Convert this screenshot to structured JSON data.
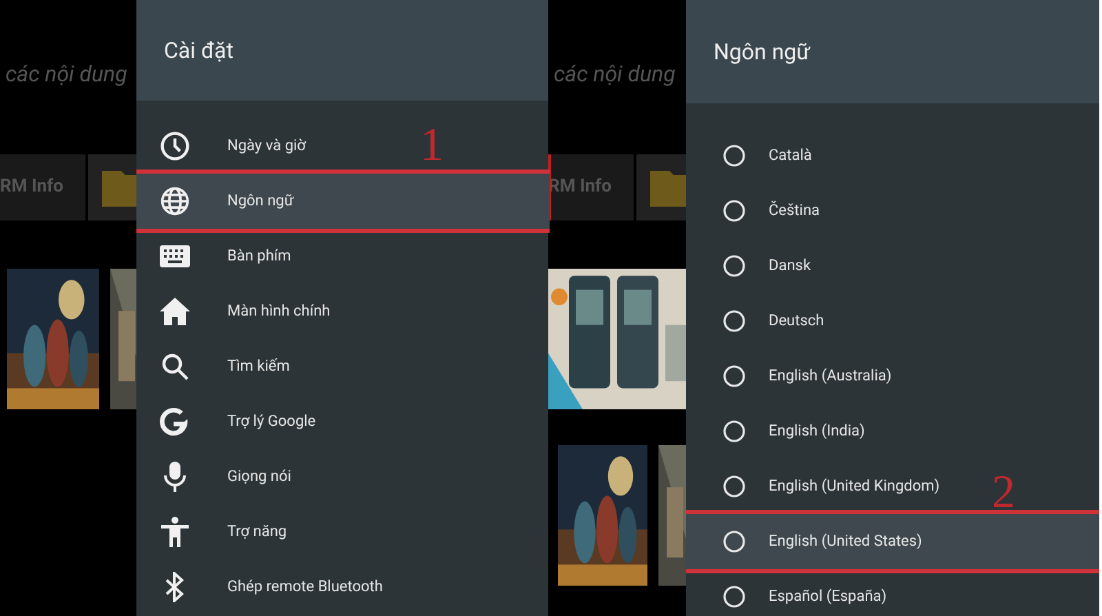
{
  "screens": [
    {
      "background": {
        "caption": "các nội dung",
        "tile": "RM Info"
      },
      "panel": {
        "kind": "menu",
        "title": "Cài đặt",
        "items": [
          {
            "label": "Ngày và giờ",
            "focused": false
          },
          {
            "label": "Ngôn ngữ",
            "focused": true
          },
          {
            "label": "Bàn phím",
            "focused": false
          },
          {
            "label": "Màn hình chính",
            "focused": false
          },
          {
            "label": "Tìm kiếm",
            "focused": false
          },
          {
            "label": "Trợ lý Google",
            "focused": false
          },
          {
            "label": "Giọng nói",
            "focused": false
          },
          {
            "label": "Trợ năng",
            "focused": false
          },
          {
            "label": "Ghép remote Bluetooth",
            "focused": false
          }
        ]
      },
      "annotation": "1"
    },
    {
      "background": {
        "caption": "các nội dung",
        "tile": "RM Info"
      },
      "panel": {
        "kind": "radio_list",
        "title": "Ngôn ngữ",
        "items": [
          {
            "label": "Català",
            "selected": false,
            "focused": false
          },
          {
            "label": "Čeština",
            "selected": false,
            "focused": false
          },
          {
            "label": "Dansk",
            "selected": false,
            "focused": false
          },
          {
            "label": "Deutsch",
            "selected": false,
            "focused": false
          },
          {
            "label": "English (Australia)",
            "selected": false,
            "focused": false
          },
          {
            "label": "English (India)",
            "selected": false,
            "focused": false
          },
          {
            "label": "English (United Kingdom)",
            "selected": false,
            "focused": false
          },
          {
            "label": "English (United States)",
            "selected": false,
            "focused": true
          },
          {
            "label": "Español (España)",
            "selected": false,
            "focused": false
          }
        ]
      },
      "annotation": "2"
    }
  ]
}
